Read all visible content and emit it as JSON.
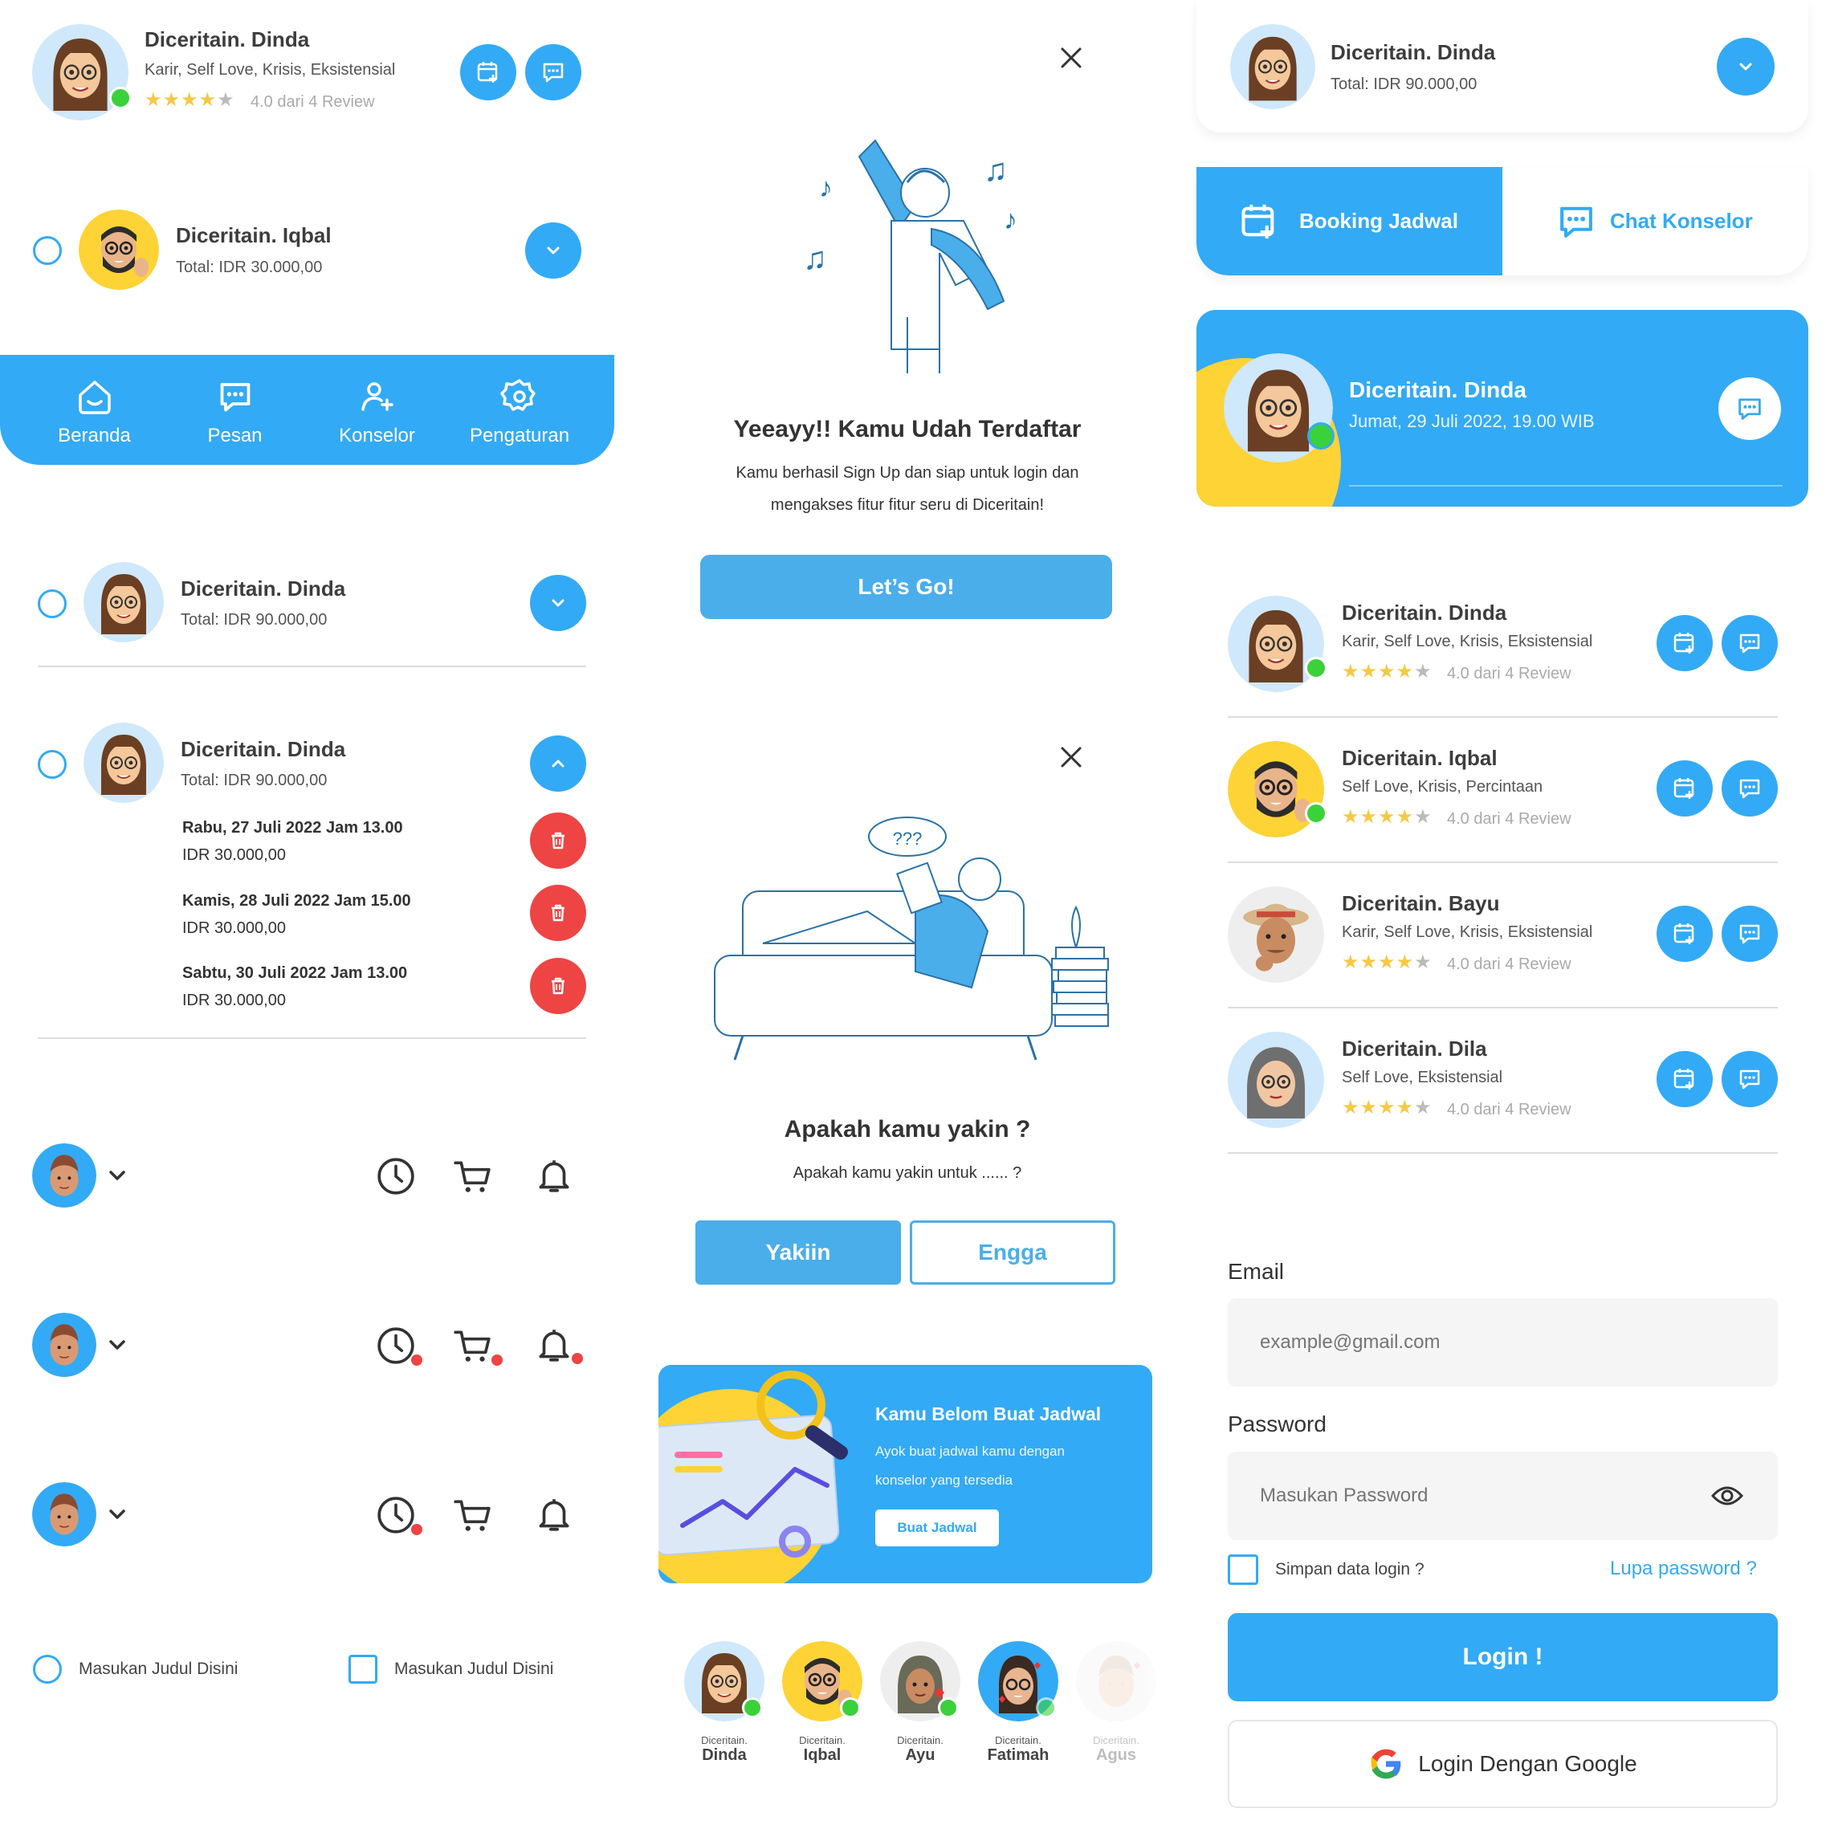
{
  "colors": {
    "primary": "#33aaf5",
    "yellow": "#fdd335",
    "red": "#ee4444",
    "green": "#3bd13b"
  },
  "c1": {
    "name": "Diceritain. Dinda",
    "tags": "Karir, Self Love, Krisis, Eksistensial",
    "rating": "4.0 dari 4 Review"
  },
  "c2": {
    "name": "Diceritain. Iqbal",
    "total": "Total: IDR 30.000,00"
  },
  "nav": {
    "items": [
      {
        "label": "Beranda",
        "icon": "home-icon"
      },
      {
        "label": "Pesan",
        "icon": "chat-icon"
      },
      {
        "label": "Konselor",
        "icon": "add-user-icon"
      },
      {
        "label": "Pengaturan",
        "icon": "gear-icon"
      }
    ]
  },
  "c3": {
    "name": "Diceritain. Dinda",
    "total": "Total: IDR 90.000,00"
  },
  "c4": {
    "name": "Diceritain. Dinda",
    "total": "Total: IDR 90.000,00",
    "items": [
      {
        "date": "Rabu, 27 Juli 2022 Jam 13.00",
        "price": "IDR 30.000,00"
      },
      {
        "date": "Kamis, 28 Juli 2022 Jam 15.00",
        "price": "IDR 30.000,00"
      },
      {
        "date": "Sabtu, 30 Juli 2022 Jam 13.00",
        "price": "IDR 30.000,00"
      }
    ]
  },
  "form_controls": {
    "radio_label": "Masukan Judul Disini",
    "checkbox_label": "Masukan Judul Disini"
  },
  "modal1": {
    "title": "Yeeayy!! Kamu Udah Terdaftar",
    "line1": "Kamu berhasil Sign Up dan siap untuk login dan",
    "line2": "mengakses fitur fitur seru di Diceritain!",
    "button": "Let’s Go!"
  },
  "modal2": {
    "bubble": "???",
    "title": "Apakah kamu yakin ?",
    "text": "Apakah kamu yakin untuk ...... ?",
    "yes": "Yakiin",
    "no": "Engga"
  },
  "promo": {
    "title": "Kamu Belom Buat Jadwal",
    "line1": "Ayok buat jadwal kamu dengan",
    "line2": "konselor yang tersedia",
    "button": "Buat Jadwal"
  },
  "stories": [
    {
      "prefix": "Diceritain.",
      "name": "Dinda"
    },
    {
      "prefix": "Diceritain.",
      "name": "Iqbal"
    },
    {
      "prefix": "Diceritain.",
      "name": "Ayu"
    },
    {
      "prefix": "Diceritain.",
      "name": "Fatimah"
    },
    {
      "prefix": "Diceritain.",
      "name": "Agus"
    }
  ],
  "r_header": {
    "name": "Diceritain. Dinda",
    "total": "Total: IDR 90.000,00"
  },
  "r_tabs": {
    "booking": "Booking Jadwal",
    "chat": "Chat Konselor"
  },
  "r_card": {
    "name": "Diceritain. Dinda",
    "when": "Jumat, 29 Juli 2022, 19.00 WIB"
  },
  "r_list": [
    {
      "name": "Diceritain. Dinda",
      "tags": "Karir, Self Love, Krisis, Eksistensial",
      "rating": "4.0 dari 4 Review"
    },
    {
      "name": "Diceritain. Iqbal",
      "tags": "Self Love, Krisis, Percintaan",
      "rating": "4.0 dari 4 Review"
    },
    {
      "name": "Diceritain. Bayu",
      "tags": "Karir, Self Love, Krisis, Eksistensial",
      "rating": "4.0 dari 4 Review"
    },
    {
      "name": "Diceritain. Dila",
      "tags": "Self Love, Eksistensial",
      "rating": "4.0 dari 4 Review"
    }
  ],
  "login": {
    "email_label": "Email",
    "email_placeholder": "example@gmail.com",
    "password_label": "Password",
    "password_placeholder": "Masukan Password",
    "remember": "Simpan data login ?",
    "forgot": "Lupa password ?",
    "login_button": "Login !",
    "google_button": "Login Dengan Google"
  }
}
